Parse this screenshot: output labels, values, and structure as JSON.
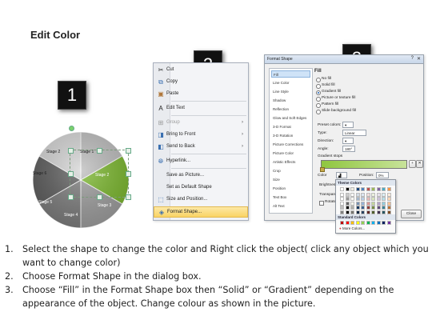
{
  "title": "Edit Color",
  "steps": {
    "one": "1",
    "two": "2",
    "three": "3"
  },
  "pie": {
    "stage1": "Stage 1",
    "stage2": "Stage 2",
    "stage3": "Stage 3",
    "stage4": "Stage 4",
    "stage5": "Stage 5",
    "stage6": "Stage 6",
    "stage2_color": "#7cb82f",
    "gray_colors": [
      "#bdbdbd",
      "#9e9e9e",
      "#7d7d7d",
      "#5f5f5f",
      "#8c8c8c",
      "#d5d5d5"
    ]
  },
  "context_menu": {
    "cut": "Cut",
    "copy": "Copy",
    "paste": "Paste",
    "edit_text": "Edit Text",
    "group": "Group",
    "bring_to_front": "Bring to Front",
    "send_to_back": "Send to Back",
    "hyperlink": "Hyperlink...",
    "save_as_picture": "Save as Picture...",
    "set_default_shape": "Set as Default Shape",
    "size_position": "Size and Position...",
    "format_shape": "Format Shape..."
  },
  "format_dialog": {
    "title": "Format Shape",
    "help": "?",
    "close_x": "✕",
    "categories": [
      "Fill",
      "Line Color",
      "Line Style",
      "Shadow",
      "Reflection",
      "Glow and Soft Edges",
      "3-D Format",
      "3-D Rotation",
      "Picture Corrections",
      "Picture Color",
      "Artistic Effects",
      "Crop",
      "Size",
      "Position",
      "Text Box",
      "Alt Text"
    ],
    "fill_header": "Fill",
    "options": [
      "No fill",
      "Solid fill",
      "Gradient fill",
      "Picture or texture fill",
      "Pattern fill",
      "Slide background fill"
    ],
    "preset_colors": "Preset colors:",
    "type_label": "Type:",
    "type_value": "Linear",
    "direction_label": "Direction:",
    "angle_label": "Angle:",
    "angle_value": "180°",
    "gradient_stops": "Gradient stops",
    "color_label": "Color",
    "position_label": "Position:",
    "position_value": "0%",
    "brightness_label": "Brightness",
    "transparency_label": "Transparency",
    "rotate_label": "Rotate with shape",
    "close_button": "Close",
    "gradient_bar_color": "#8fc63f"
  },
  "palette": {
    "theme_colors": "Theme Colors",
    "standard_colors": "Standard Colors",
    "more_colors": "More Colors...",
    "top_row": [
      "#ffffff",
      "#000000",
      "#eeece1",
      "#1f497d",
      "#4f81bd",
      "#c0504d",
      "#9bbb59",
      "#8064a2",
      "#4bacc6",
      "#f79646"
    ],
    "standard": [
      "#c00000",
      "#ff0000",
      "#ffc000",
      "#ffff00",
      "#92d050",
      "#00b050",
      "#00b0f0",
      "#0070c0",
      "#002060",
      "#7030a0"
    ]
  },
  "instructions": {
    "n1": "1.",
    "l1a": "Select the shape to change the color and Right click the object( click any object which you",
    "l1b": "want to change color)",
    "n2": "2.",
    "l2": "Choose Format Shape in the dialog box.",
    "n3": "3.",
    "l3a": "Choose “Fill” in the Format Shape box then “Solid” or “Gradient” depending on the",
    "l3b": "appearance of the object. Change colour as shown in the picture."
  }
}
